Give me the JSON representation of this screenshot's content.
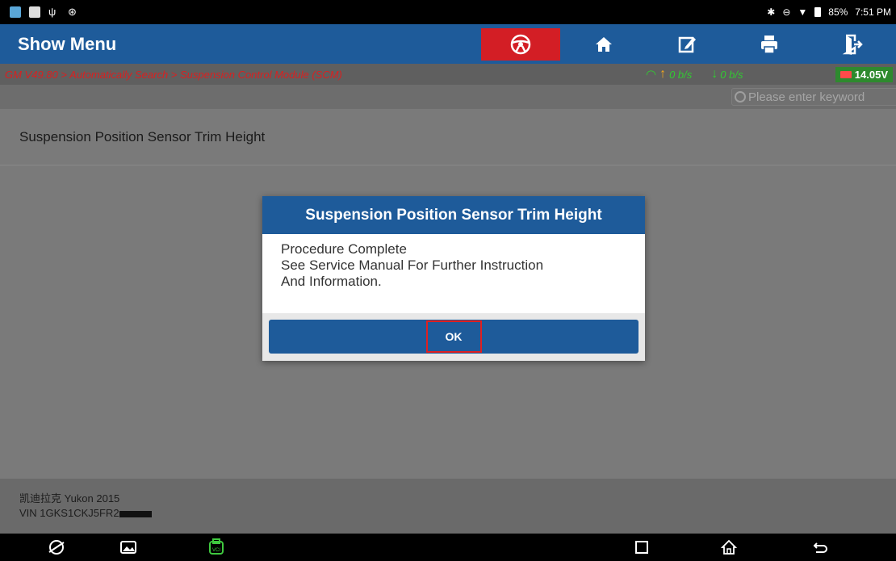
{
  "statusbar": {
    "icons_left": [
      "app-icon",
      "image-icon",
      "usb-icon",
      "settings-icon"
    ],
    "battery": "85%",
    "time": "7:51 PM"
  },
  "header": {
    "title": "Show Menu",
    "buttons": [
      "steering-wheel-icon",
      "home-icon",
      "edit-icon",
      "print-icon",
      "exit-icon"
    ],
    "accent": "#d31e25",
    "bg": "#1e5b9a"
  },
  "breadcrumb": {
    "path": "GM V49.80 > Automatically Search > Suspension Control Module (SCM)",
    "upload": "0 b/s",
    "download": "0 b/s",
    "voltage": "14.05V"
  },
  "search": {
    "placeholder": "Please enter keyword"
  },
  "list": {
    "item": "Suspension Position Sensor Trim Height"
  },
  "dialog": {
    "title": "Suspension Position Sensor Trim Height",
    "line1": "Procedure Complete",
    "line2": "See Service Manual For Further Instruction",
    "line3": "And Information.",
    "ok_label": "OK"
  },
  "footer": {
    "vehicle": "凯迪拉克 Yukon 2015",
    "vin": "VIN 1GKS1CKJ5FR2"
  },
  "navbar": {
    "icons": [
      "browser-icon",
      "gallery-icon",
      "vci-icon",
      "recent-apps-icon",
      "home-nav-icon",
      "back-icon"
    ]
  }
}
